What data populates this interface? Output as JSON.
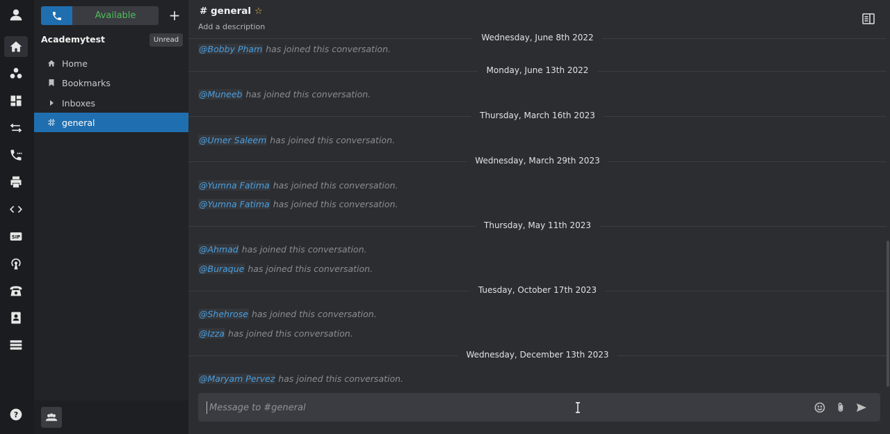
{
  "sidebar": {
    "status": "Available",
    "workspace": "Academytest",
    "unread_badge": "Unread",
    "nav": [
      {
        "label": "Home"
      },
      {
        "label": "Bookmarks"
      },
      {
        "label": "Inboxes"
      },
      {
        "label": "general"
      }
    ]
  },
  "channel": {
    "title": "general",
    "hash": "#",
    "star": "☆",
    "description": "Add a description"
  },
  "messages": {
    "joined_text": "has joined this conversation.",
    "dates": [
      "Wednesday, June 8th 2022",
      "Monday, June 13th 2022",
      "Thursday, March 16th 2023",
      "Wednesday, March 29th 2023",
      "Thursday, May 11th 2023",
      "Tuesday, October 17th 2023",
      "Wednesday, December 13th 2023"
    ],
    "users": [
      "@Bobby Pham",
      "@Muneeb",
      "@Umer Saleem",
      "@Yumna Fatima",
      "@Yumna Fatima",
      "@Ahmad",
      "@Buraque",
      "@Shehrose",
      "@Izza",
      "@Maryam Pervez"
    ]
  },
  "composer": {
    "placeholder": "Message to #general"
  }
}
